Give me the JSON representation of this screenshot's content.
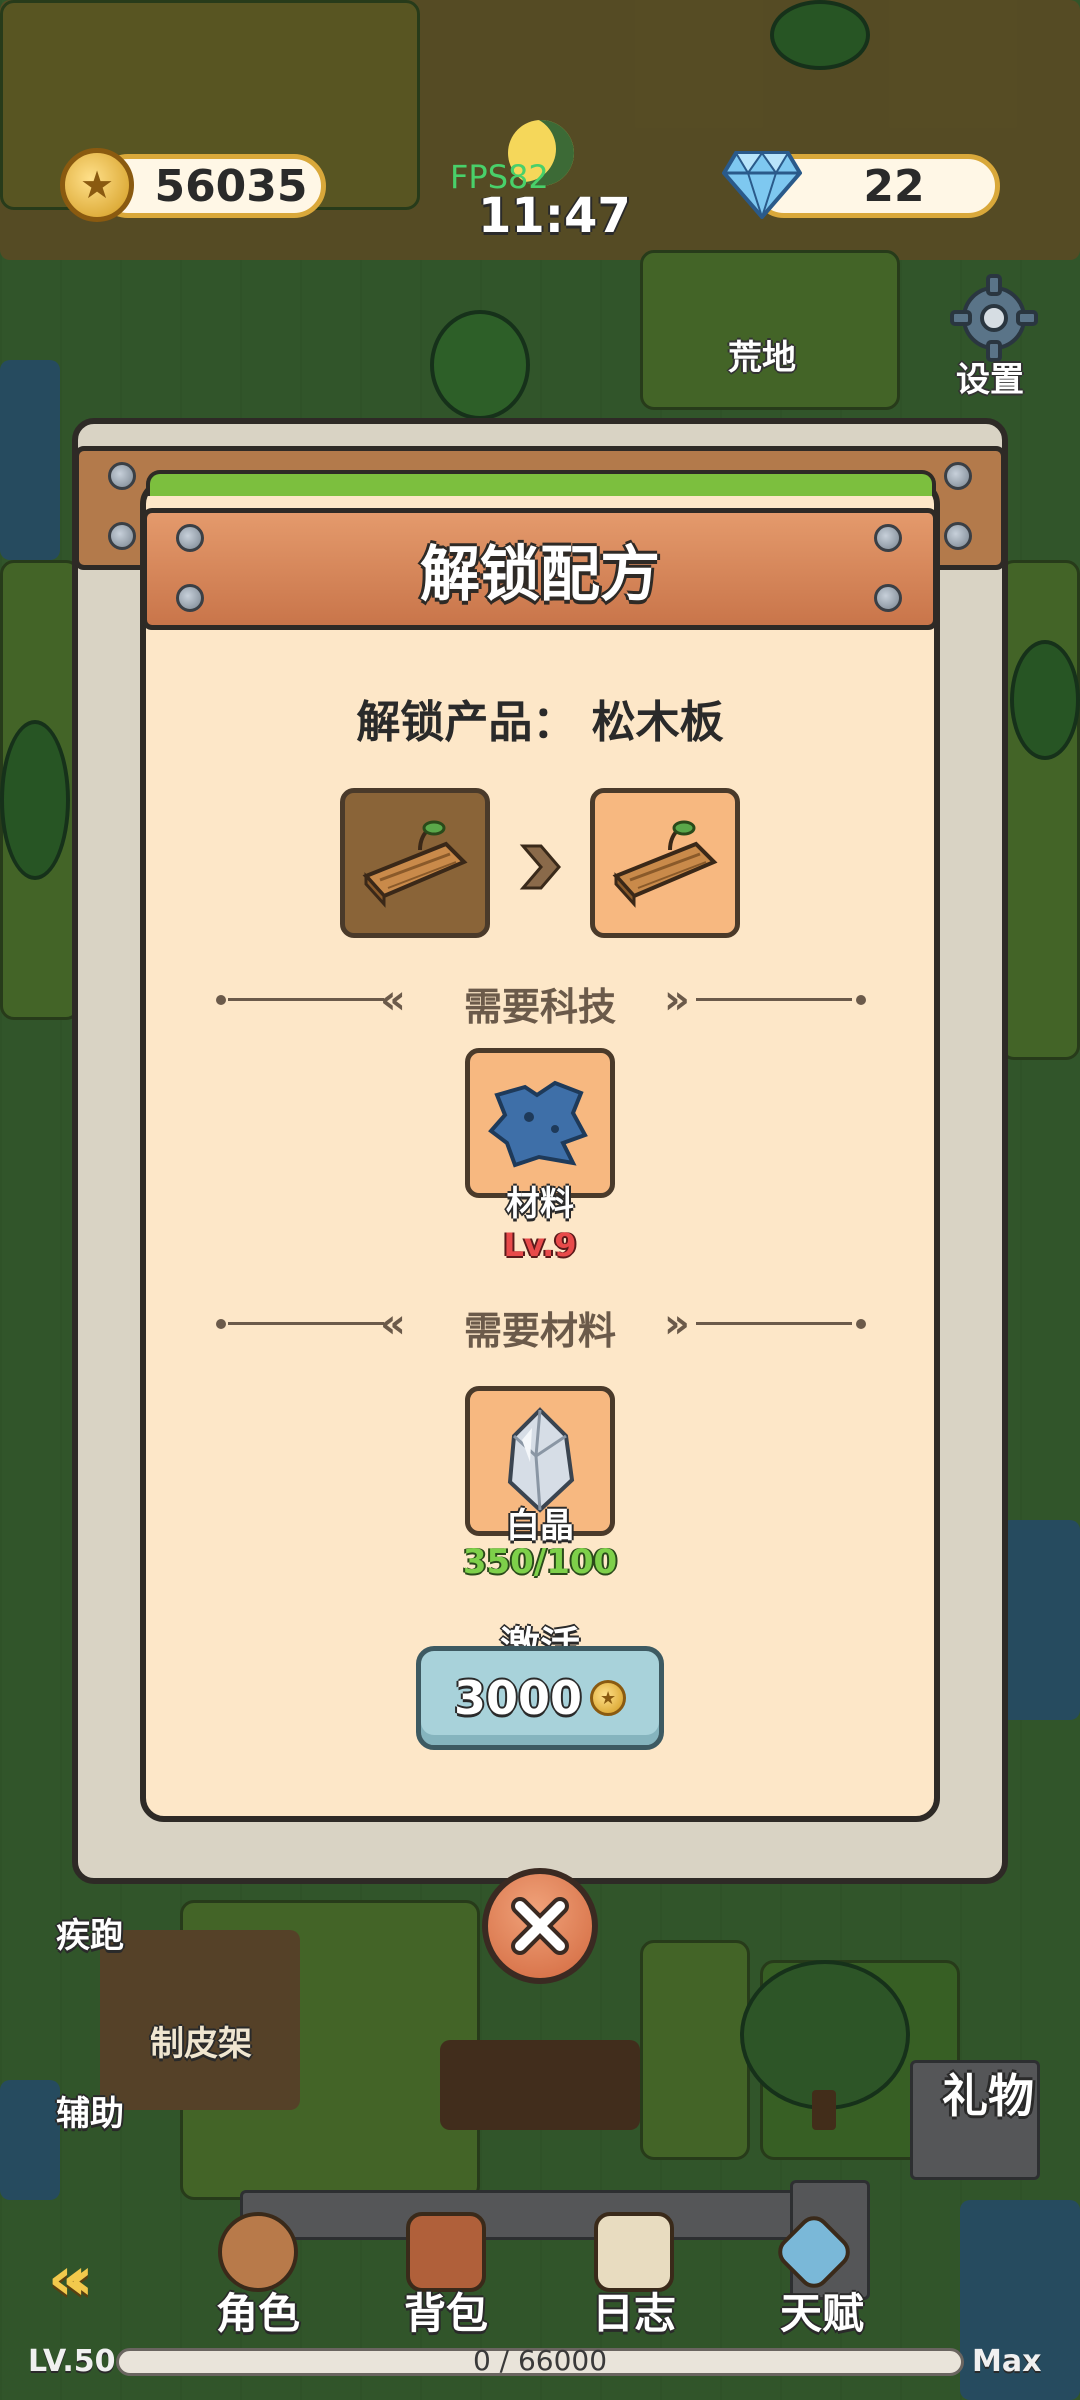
{
  "hud": {
    "coins": "56035",
    "gems": "22",
    "fps": "FPS82",
    "clock": "11:47"
  },
  "map": {
    "wasteland_label": "荒地",
    "settings_label": "设置",
    "leather_rack_label": "制皮架",
    "sprint_label": "疾跑",
    "assist_label": "辅助",
    "gift_label": "礼物"
  },
  "dialog": {
    "title": "解锁配方",
    "unlock_product": "解锁产品： 松木板",
    "tech_section": "需要科技",
    "tech_item": {
      "name": "材料",
      "level": "Lv.9"
    },
    "material_section": "需要材料",
    "material_item": {
      "name": "白晶",
      "count": "350/100"
    },
    "activate_label": "激活",
    "activate_price": "3000"
  },
  "bottom_nav": {
    "tabs": [
      "角色",
      "背包",
      "日志",
      "天赋"
    ]
  },
  "xp": {
    "level": "LV.50",
    "progress_text": "0 / 66000",
    "progress_fraction": 0.0,
    "max_label": "Max"
  },
  "colors": {
    "panel_bg": "#fde7c8",
    "title_plank": "#d9845a",
    "level_red": "#e84a4a",
    "count_green": "#7ed04a",
    "activate_btn": "#a8d2da"
  }
}
